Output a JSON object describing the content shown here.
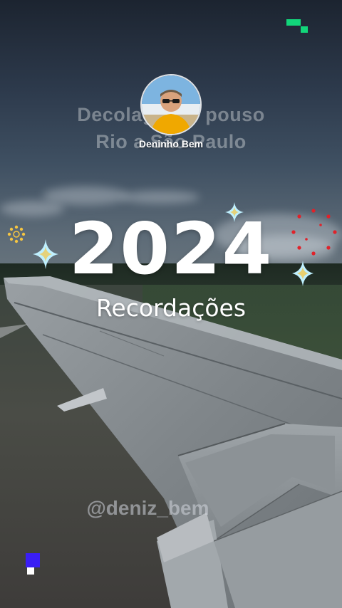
{
  "story": {
    "ghost_title_line1": "Decolagem e pouso",
    "ghost_title_line2": "Rio a São Paulo",
    "author_name": "Deninho Bem",
    "year": "2024",
    "subtitle": "Recordações",
    "handle": "@deniz_bem"
  },
  "colors": {
    "accent_green": "#12d67a",
    "accent_blue": "#3a1ef5",
    "sparkle_gold": "#f5c542",
    "sparkle_cyan": "#bff0ff",
    "firework_red": "#e0222a"
  },
  "icons": [
    "sparkle-icon",
    "sun-icon",
    "firework-icon",
    "pixel-blocks-icon",
    "avatar"
  ]
}
